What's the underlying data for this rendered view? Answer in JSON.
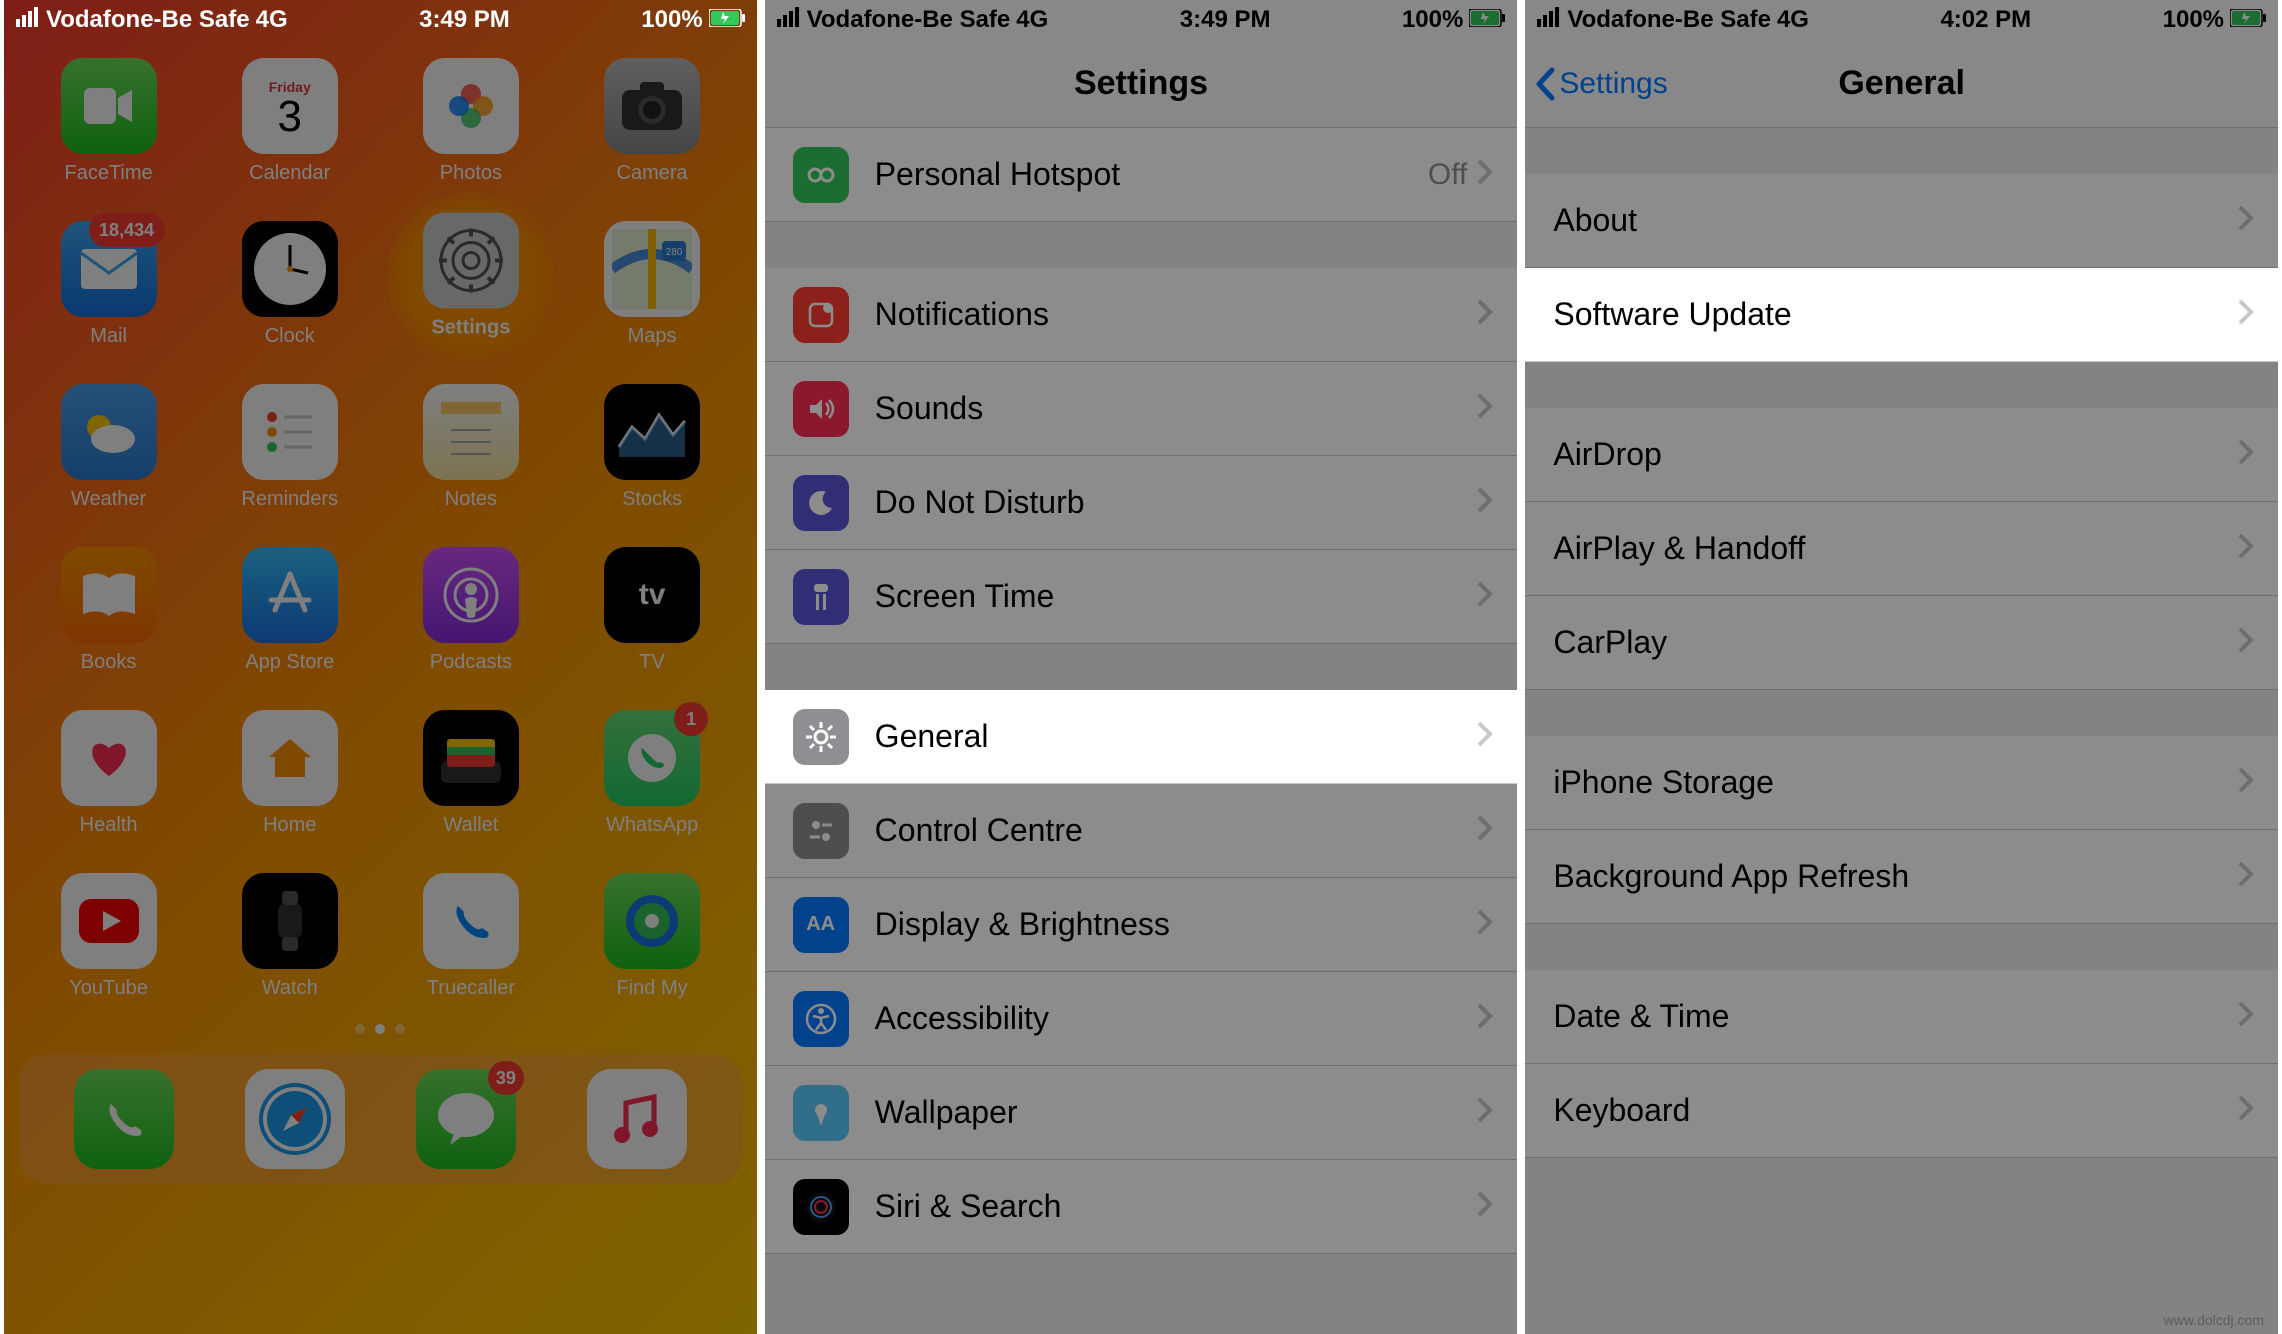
{
  "status": {
    "carrier": "Vodafone-Be Safe",
    "network": "4G",
    "time_1": "3:49 PM",
    "time_2": "3:49 PM",
    "time_3": "4:02 PM",
    "battery": "100%"
  },
  "home": {
    "highlighted_app": "Settings",
    "calendar_day": "Friday",
    "calendar_date": "3",
    "apps_row1": [
      {
        "name": "FaceTime",
        "icon": "facetime"
      },
      {
        "name": "Calendar",
        "icon": "calendar"
      },
      {
        "name": "Photos",
        "icon": "photos"
      },
      {
        "name": "Camera",
        "icon": "camera"
      }
    ],
    "apps_row2": [
      {
        "name": "Mail",
        "icon": "mail",
        "badge": "18,434"
      },
      {
        "name": "Clock",
        "icon": "clock"
      },
      {
        "name": "Settings",
        "icon": "settings"
      },
      {
        "name": "Maps",
        "icon": "maps"
      }
    ],
    "apps_row3": [
      {
        "name": "Weather",
        "icon": "weather"
      },
      {
        "name": "Reminders",
        "icon": "reminders"
      },
      {
        "name": "Notes",
        "icon": "notes"
      },
      {
        "name": "Stocks",
        "icon": "stocks"
      }
    ],
    "apps_row4": [
      {
        "name": "Books",
        "icon": "books"
      },
      {
        "name": "App Store",
        "icon": "appstore"
      },
      {
        "name": "Podcasts",
        "icon": "podcasts"
      },
      {
        "name": "TV",
        "icon": "tv"
      }
    ],
    "apps_row5": [
      {
        "name": "Health",
        "icon": "health"
      },
      {
        "name": "Home",
        "icon": "home"
      },
      {
        "name": "Wallet",
        "icon": "wallet"
      },
      {
        "name": "WhatsApp",
        "icon": "whatsapp",
        "badge": "1"
      }
    ],
    "apps_row6": [
      {
        "name": "YouTube",
        "icon": "youtube"
      },
      {
        "name": "Watch",
        "icon": "watch"
      },
      {
        "name": "Truecaller",
        "icon": "truecaller"
      },
      {
        "name": "Find My",
        "icon": "findmy"
      }
    ],
    "dock": [
      {
        "name": "Phone",
        "icon": "phone"
      },
      {
        "name": "Safari",
        "icon": "safari"
      },
      {
        "name": "Messages",
        "icon": "messages",
        "badge": "39"
      },
      {
        "name": "Music",
        "icon": "music"
      }
    ]
  },
  "settings": {
    "title": "Settings",
    "highlighted_row": "General",
    "rows": {
      "hotspot": {
        "label": "Personal Hotspot",
        "value": "Off"
      },
      "notifications": {
        "label": "Notifications"
      },
      "sounds": {
        "label": "Sounds"
      },
      "dnd": {
        "label": "Do Not Disturb"
      },
      "screentime": {
        "label": "Screen Time"
      },
      "general": {
        "label": "General"
      },
      "control": {
        "label": "Control Centre"
      },
      "display": {
        "label": "Display & Brightness"
      },
      "accessibility": {
        "label": "Accessibility"
      },
      "wallpaper": {
        "label": "Wallpaper"
      },
      "siri": {
        "label": "Siri & Search"
      }
    }
  },
  "general": {
    "title": "General",
    "back_label": "Settings",
    "highlighted_row": "Software Update",
    "rows": {
      "about": "About",
      "software_update": "Software Update",
      "airdrop": "AirDrop",
      "airplay": "AirPlay & Handoff",
      "carplay": "CarPlay",
      "storage": "iPhone Storage",
      "refresh": "Background App Refresh",
      "datetime": "Date & Time",
      "keyboard": "Keyboard"
    }
  },
  "icons": {
    "facetime": "◉",
    "photos": "✿",
    "camera": "📷",
    "mail": "✉",
    "clock": "🕙",
    "settings_gear": "⚙",
    "maps": "➤",
    "weather": "☁",
    "reminders": "☰",
    "notes": "▤",
    "stocks": "〰",
    "books": "📖",
    "appstore": "A",
    "podcasts": "◉",
    "tv": "tv",
    "health": "♥",
    "home_house": "⌂",
    "wallet": "▬",
    "whatsapp": "✆",
    "youtube": "▶",
    "watch": "⌚",
    "truecaller": "✆",
    "findmy": "◉",
    "phone": "✆",
    "safari": "✪",
    "messages": "💬",
    "music": "♫"
  }
}
